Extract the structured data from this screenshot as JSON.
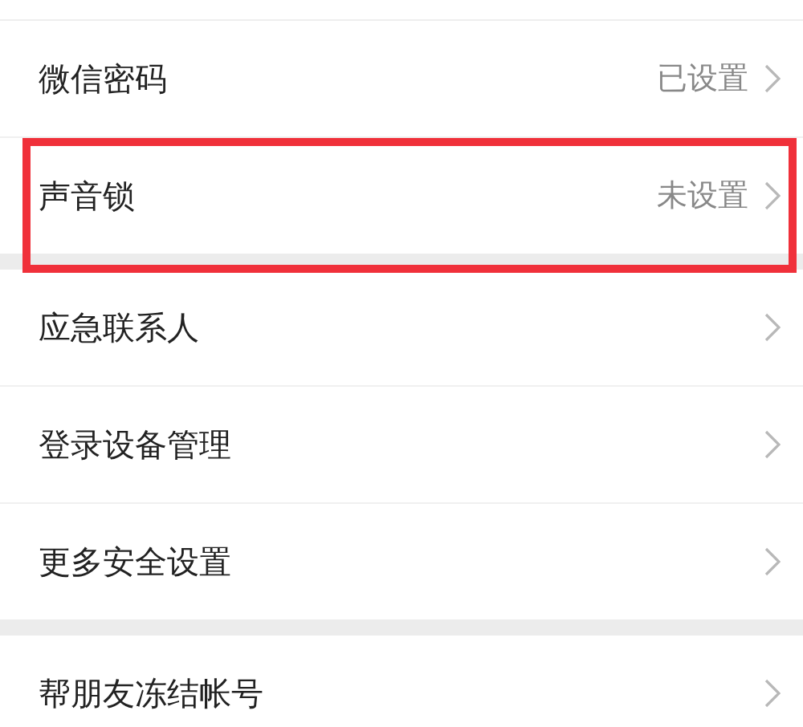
{
  "sections": [
    {
      "items": [
        {
          "label": "微信密码",
          "value": "已设置",
          "highlighted": false
        },
        {
          "label": "声音锁",
          "value": "未设置",
          "highlighted": true
        }
      ]
    },
    {
      "items": [
        {
          "label": "应急联系人",
          "highlighted": false
        },
        {
          "label": "登录设备管理",
          "highlighted": false
        },
        {
          "label": "更多安全设置",
          "highlighted": false
        }
      ]
    },
    {
      "items": [
        {
          "label": "帮朋友冻结帐号",
          "highlighted": false
        }
      ]
    }
  ]
}
